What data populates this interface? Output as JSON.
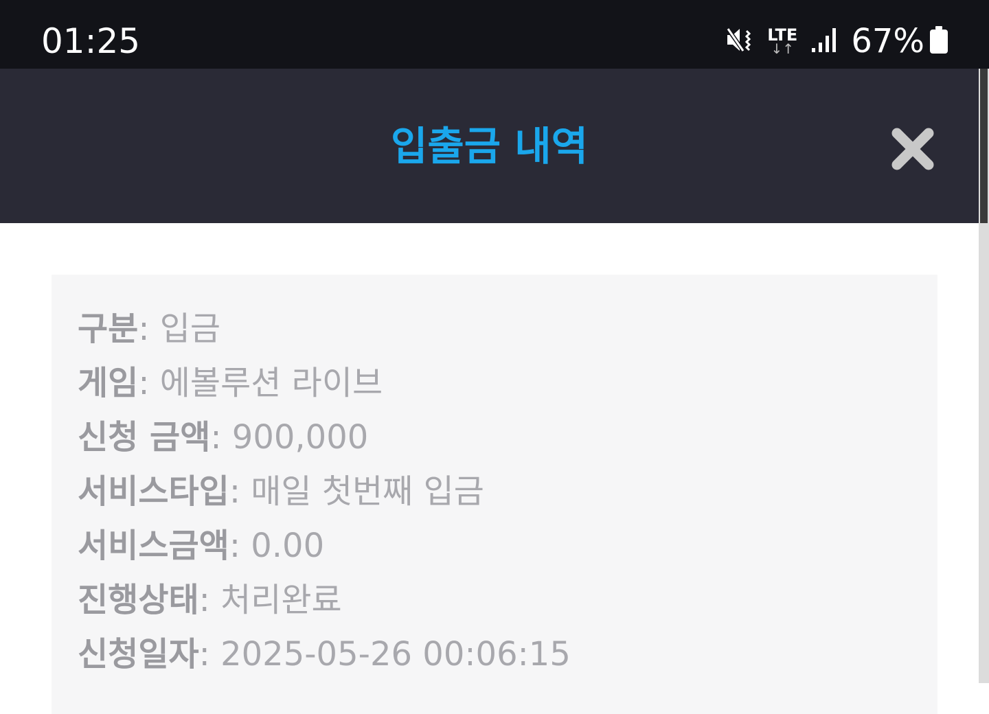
{
  "status_bar": {
    "time": "01:25",
    "network": "LTE",
    "network_arrows": "↓↑",
    "battery_pct": "67%"
  },
  "header": {
    "title": "입출금 내역",
    "title_color": "#1aa7ec"
  },
  "details": [
    {
      "key": "구분",
      "value": "입금"
    },
    {
      "key": "게임",
      "value": "에볼루션 라이브"
    },
    {
      "key": "신청 금액",
      "value": "900,000"
    },
    {
      "key": "서비스타입",
      "value": "매일 첫번째 입금"
    },
    {
      "key": "서비스금액",
      "value": "0.00"
    },
    {
      "key": "진행상태",
      "value": "처리완료"
    },
    {
      "key": "신청일자",
      "value": "2025-05-26 00:06:15"
    }
  ],
  "separator": ": ",
  "icons": {
    "mute": "mute-vibrate-icon",
    "signal": "signal-bars-icon",
    "battery": "battery-icon",
    "close": "close-icon"
  }
}
